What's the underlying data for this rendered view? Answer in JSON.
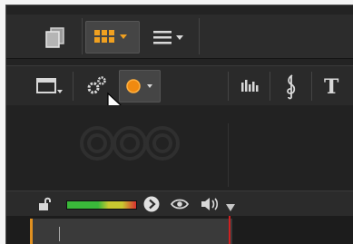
{
  "toolbar_top": {
    "items": [
      {
        "name": "copy-icon",
        "active": false
      },
      {
        "name": "storyboard-grid-icon",
        "active": true,
        "color": "#f0a020"
      },
      {
        "name": "list-view-icon",
        "active": false
      }
    ]
  },
  "toolbar_second": {
    "items": [
      {
        "name": "monitor-dropdown-icon"
      },
      {
        "name": "settings-gear-icon"
      },
      {
        "name": "record-dot-icon",
        "active": true,
        "color": "#f08a10"
      },
      {
        "name": "audio-mixer-icon"
      },
      {
        "name": "music-clef-icon",
        "glyph": "𝄞"
      },
      {
        "name": "title-text-icon",
        "glyph": "T"
      }
    ]
  },
  "panel": {
    "watermark": "three-circles-logo"
  },
  "track_header": {
    "lock": "unlock-icon",
    "level_meter": {
      "green": "#3ab83a",
      "yellow": "#c8c830",
      "red": "#d83030"
    },
    "play": "play-circle-icon",
    "visibility": "eye-icon",
    "volume": "speaker-icon"
  },
  "colors": {
    "accent": "#f0a020",
    "playhead": "#d02020"
  }
}
